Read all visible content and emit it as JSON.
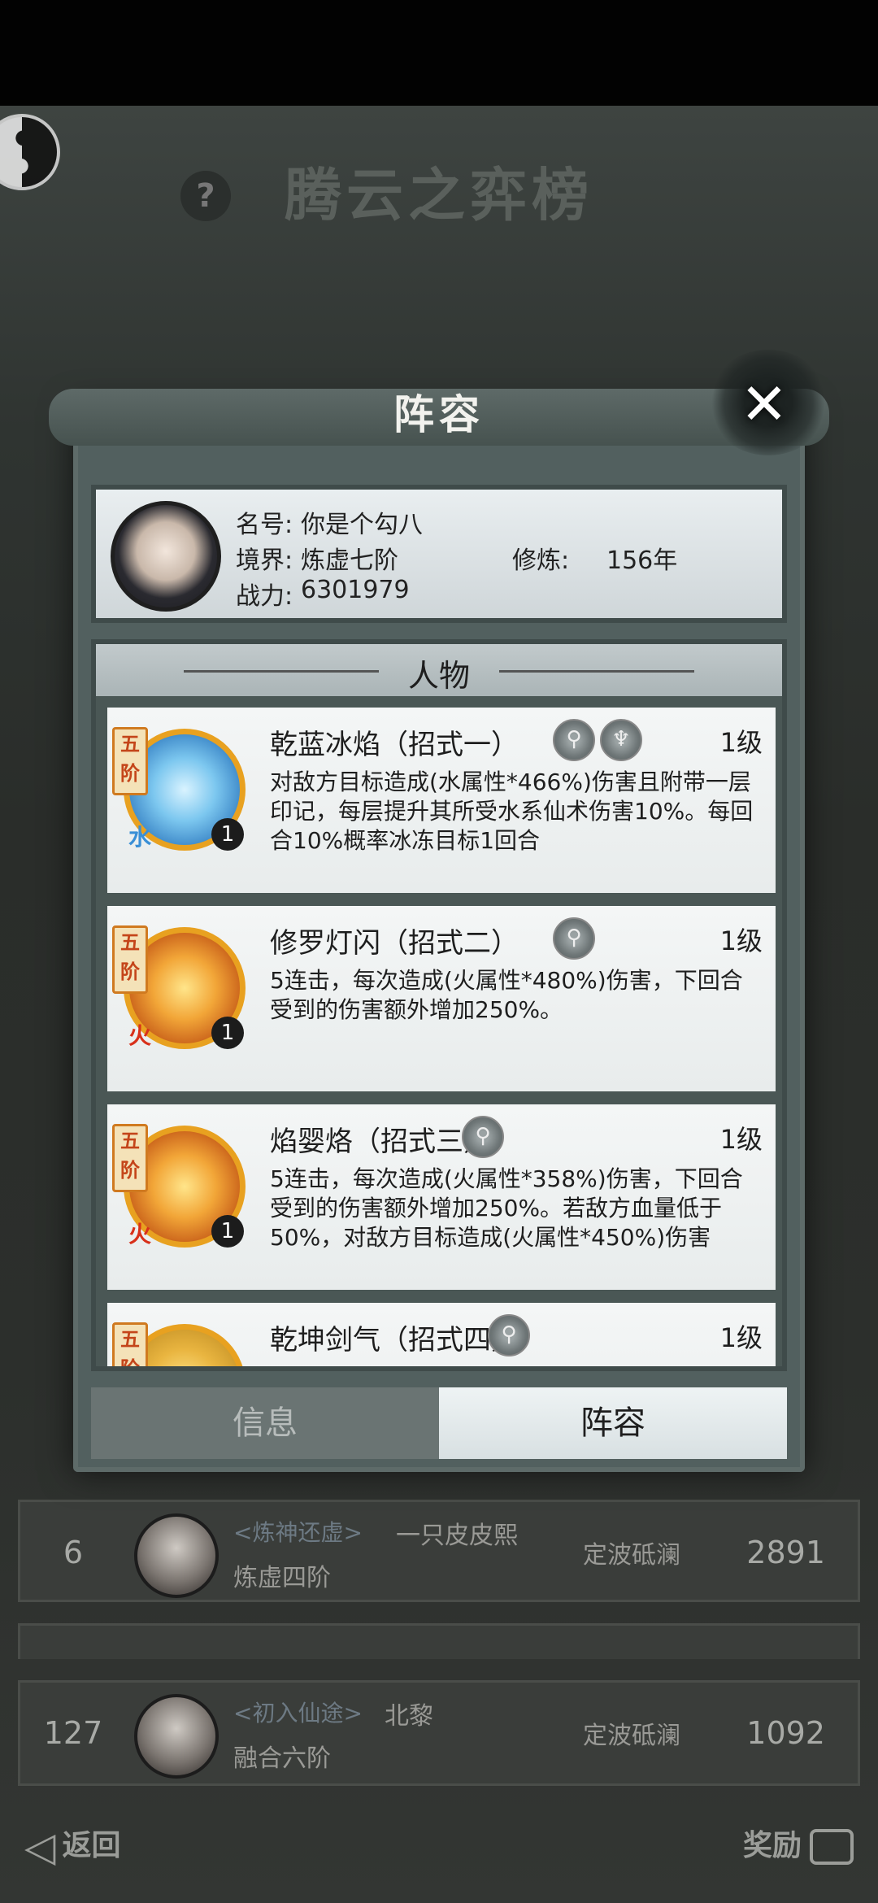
{
  "background": {
    "title": "腾云之弈榜",
    "help_label": "?",
    "rows": [
      {
        "rank": "6",
        "title_tag": "<炼神还虚>",
        "name": "一只皮皮熙",
        "realm": "炼虚四阶",
        "sect": "定波砥澜",
        "power": "2891"
      },
      {
        "rank": "127",
        "title_tag": "<初入仙途>",
        "name": "北黎",
        "realm": "融合六阶",
        "sect": "定波砥澜",
        "power": "1092"
      }
    ],
    "back_label": "返回",
    "reward_label": "奖励"
  },
  "modal": {
    "title": "阵容",
    "close_label": "✕",
    "profile": {
      "name_label": "名号:",
      "name_value": "你是个勾八",
      "realm_label": "境界:",
      "realm_value": "炼虚七阶",
      "cultivation_label": "修炼:",
      "cultivation_value": "156年",
      "power_label": "战力:",
      "power_value": "6301979"
    },
    "section_title": "人物",
    "skills": [
      {
        "tier": "五阶",
        "element": "水",
        "badge": "1",
        "name": "乾蓝冰焰（招式一）",
        "level": "1级",
        "desc": "对敌方目标造成(水属性*466%)伤害且附带一层印记，每层提升其所受水系仙术伤害10%。每回合10%概率冰冻目标1回合"
      },
      {
        "tier": "五阶",
        "element": "火",
        "badge": "1",
        "name": "修罗灯闪（招式二）",
        "level": "1级",
        "desc": "5连击，每次造成(火属性*480%)伤害，下回合受到的伤害额外增加250%。"
      },
      {
        "tier": "五阶",
        "element": "火",
        "badge": "1",
        "name": "焰婴烙（招式三）",
        "level": "1级",
        "desc": "5连击，每次造成(火属性*358%)伤害，下回合受到的伤害额外增加250%。若敌方血量低于50%，对敌方目标造成(火属性*450%)伤害"
      },
      {
        "tier": "五阶",
        "element": "",
        "badge": "",
        "name": "乾坤剑气（招式四）",
        "level": "1级",
        "desc": ""
      }
    ],
    "tabs": [
      "信息",
      "阵容"
    ]
  }
}
